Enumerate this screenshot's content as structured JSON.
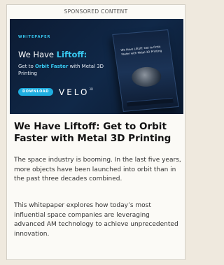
{
  "ad": {
    "label": "SPONSORED CONTENT",
    "banner": {
      "tag": "WHITEPAPER",
      "title_prefix": "We Have ",
      "title_accent": "Liftoff:",
      "subtitle_prefix": "Get to ",
      "subtitle_accent": "Orbit Faster",
      "subtitle_suffix": " with Metal 3D Printing",
      "button_label": "DOWNLOAD",
      "brand": "VELO",
      "brand_mark": "3D",
      "mockup_title": "We Have Liftoff: Get to Orbit Faster with Metal 3D Printing"
    },
    "headline": "We Have Liftoff: Get to Orbit Faster with Metal 3D Printing",
    "paragraphs": [
      "The space industry is booming. In the last five years, more objects have been launched into orbit than in the past three decades combined.",
      "This whitepaper explores how today’s most influential space companies are leveraging advanced AM technology to achieve unprecedented innovation."
    ]
  },
  "colors": {
    "banner_bg": "#0c1b33",
    "accent": "#38c7ef",
    "button": "#1faee0",
    "headline": "#111111",
    "body_text": "#333333"
  }
}
